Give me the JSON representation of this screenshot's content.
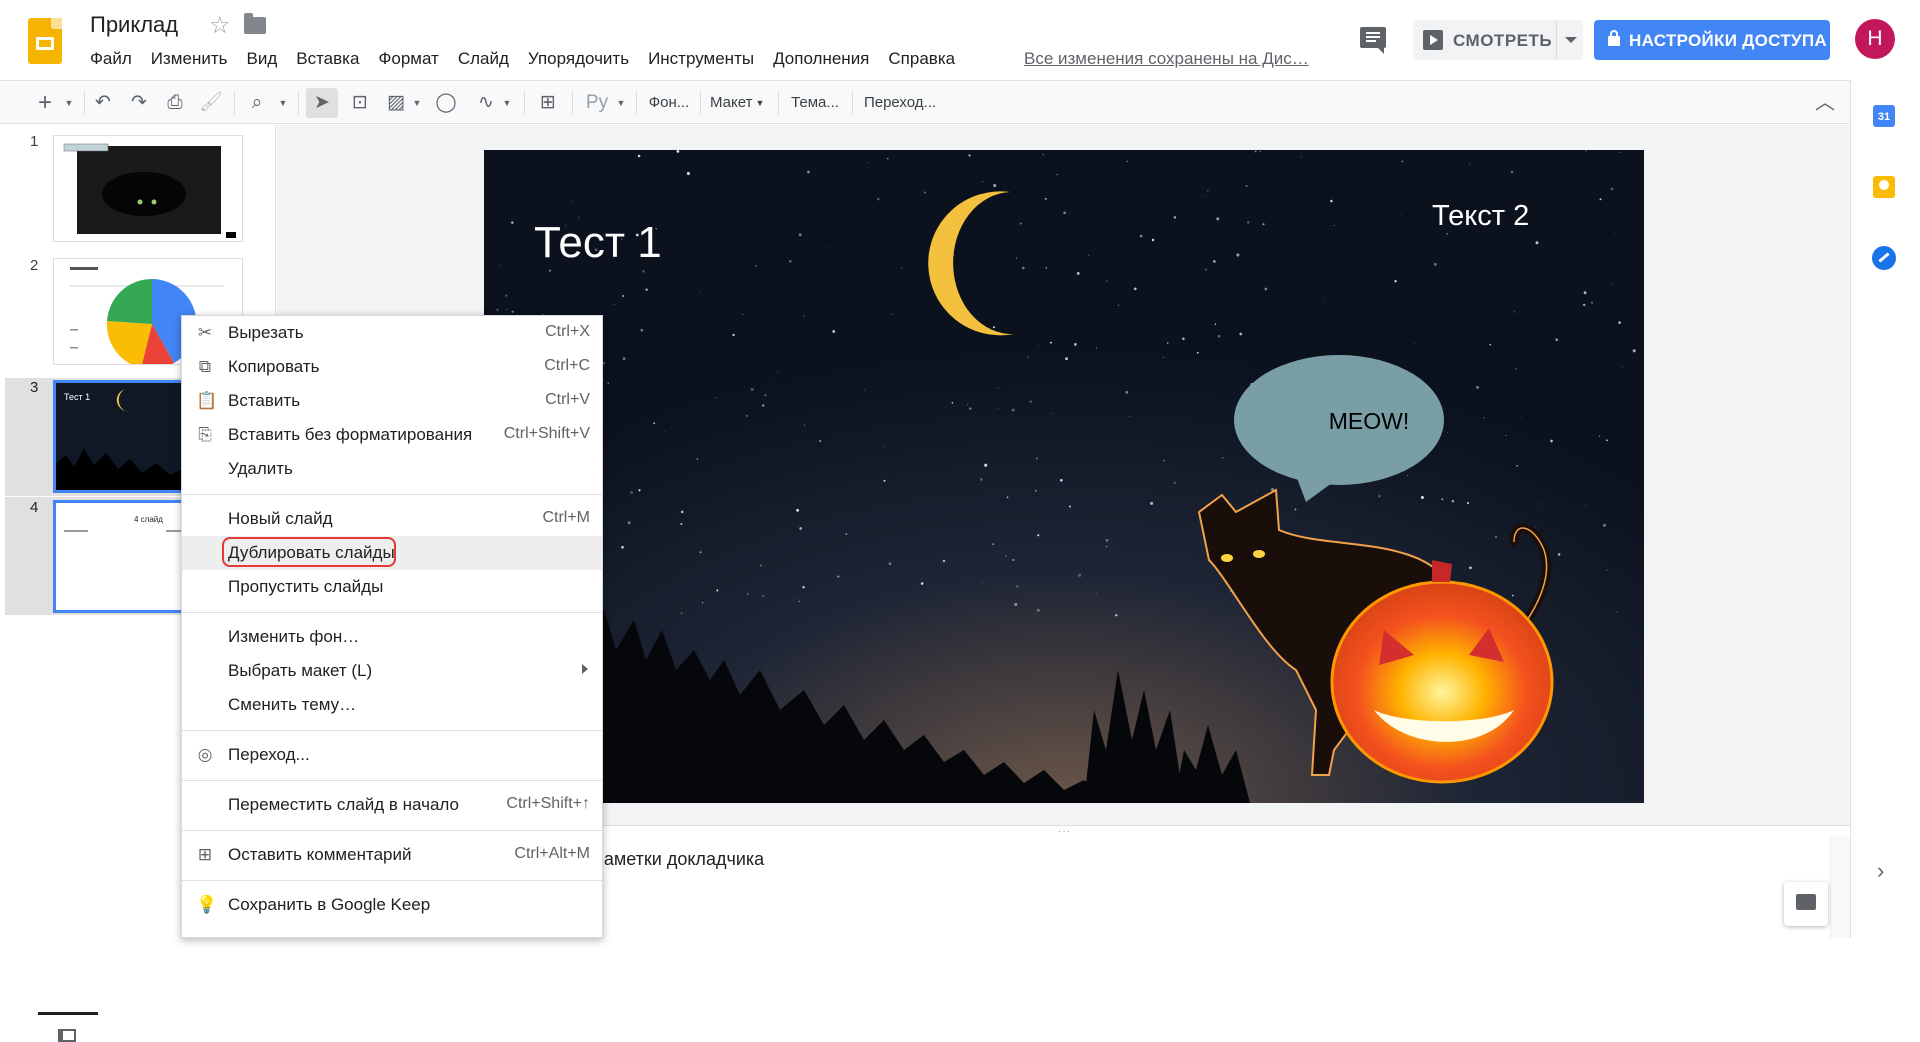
{
  "header": {
    "doc_title": "Приклад",
    "menu": [
      "Файл",
      "Изменить",
      "Вид",
      "Вставка",
      "Формат",
      "Слайд",
      "Упорядочить",
      "Инструменты",
      "Дополнения",
      "Справка"
    ],
    "save_status": "Все изменения сохранены на Дис…",
    "present_label": "СМОТРЕТЬ",
    "share_label": "НАСТРОЙКИ ДОСТУПА",
    "avatar_letter": "Н"
  },
  "toolbar": {
    "input_tools": "Ру",
    "background": "Фон...",
    "layout": "Макет",
    "theme": "Тема...",
    "transition": "Переход..."
  },
  "side_panel": {
    "calendar_day": "31"
  },
  "filmstrip": {
    "slides": [
      {
        "number": "1"
      },
      {
        "number": "2"
      },
      {
        "number": "3",
        "title": "Тест 1"
      },
      {
        "number": "4",
        "title": "4 слайд"
      }
    ]
  },
  "slide": {
    "title": "Тест 1",
    "text2": "Текст 2",
    "bubble": "MEOW!"
  },
  "notes": {
    "text": "Заметки докладчика"
  },
  "context_menu": {
    "items": [
      {
        "label": "Вырезать",
        "shortcut": "Ctrl+X",
        "icon": "scissors-icon"
      },
      {
        "label": "Копировать",
        "shortcut": "Ctrl+C",
        "icon": "copy-icon"
      },
      {
        "label": "Вставить",
        "shortcut": "Ctrl+V",
        "icon": "paste-icon"
      },
      {
        "label": "Вставить без форматирования",
        "shortcut": "Ctrl+Shift+V",
        "icon": "paste-plain-icon"
      },
      {
        "label": "Удалить",
        "shortcut": ""
      },
      {
        "label": "Новый слайд",
        "shortcut": "Ctrl+M"
      },
      {
        "label": "Дублировать слайды",
        "shortcut": ""
      },
      {
        "label": "Пропустить слайды",
        "shortcut": ""
      },
      {
        "label": "Изменить фон…",
        "shortcut": ""
      },
      {
        "label": "Выбрать макет (L)",
        "shortcut": ""
      },
      {
        "label": "Сменить тему…",
        "shortcut": ""
      },
      {
        "label": "Переход...",
        "shortcut": "",
        "icon": "transition-icon"
      },
      {
        "label": "Переместить слайд в начало",
        "shortcut": "Ctrl+Shift+↑"
      },
      {
        "label": "Оставить комментарий",
        "shortcut": "Ctrl+Alt+M",
        "icon": "comment-add-icon"
      },
      {
        "label": "Сохранить в Google Keep",
        "shortcut": "",
        "icon": "keep-bulb-icon"
      }
    ]
  },
  "colors": {
    "accent": "#4285f4",
    "highlight_ring": "#e53935",
    "avatar": "#c2185b",
    "logo": "#f4b400"
  }
}
